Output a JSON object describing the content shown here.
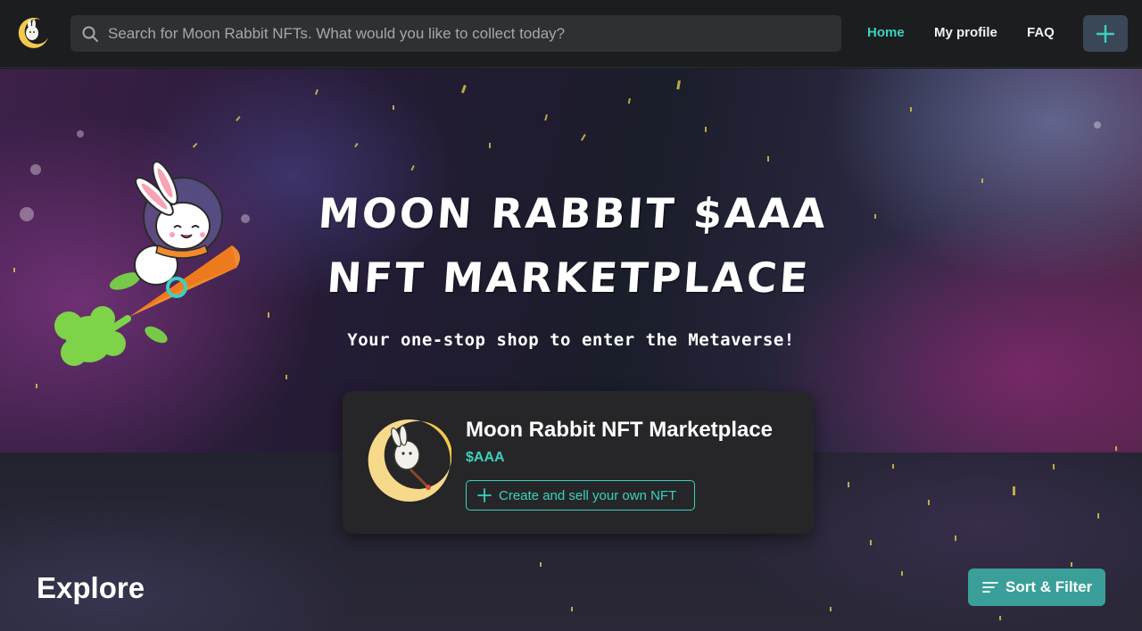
{
  "colors": {
    "accent": "#3bd1c0",
    "topbar_bg": "#1b1d1f",
    "card_bg": "#262628",
    "sort_button_bg": "#3a9f98",
    "plus_button_bg": "#3a4757"
  },
  "header": {
    "logo_icon": "moon-rabbit-logo-icon",
    "search": {
      "icon": "search-icon",
      "placeholder": "Search for Moon Rabbit NFTs. What would you like to collect today?",
      "value": ""
    },
    "nav": {
      "home": "Home",
      "my_profile": "My profile",
      "faq": "FAQ"
    },
    "create_icon": "plus-icon"
  },
  "hero": {
    "title_line1": "MOON RABBIT $AAA",
    "title_line2": "NFT MARKETPLACE",
    "subtitle": "Your one-stop shop to enter the Metaverse!",
    "mascot": "rabbit-riding-carrot-rocket-illustration"
  },
  "card": {
    "title": "Moon Rabbit NFT Marketplace",
    "ticker": "$AAA",
    "create_button": "Create and sell your own NFT"
  },
  "explore": {
    "heading": "Explore",
    "sort_button": "Sort & Filter"
  }
}
